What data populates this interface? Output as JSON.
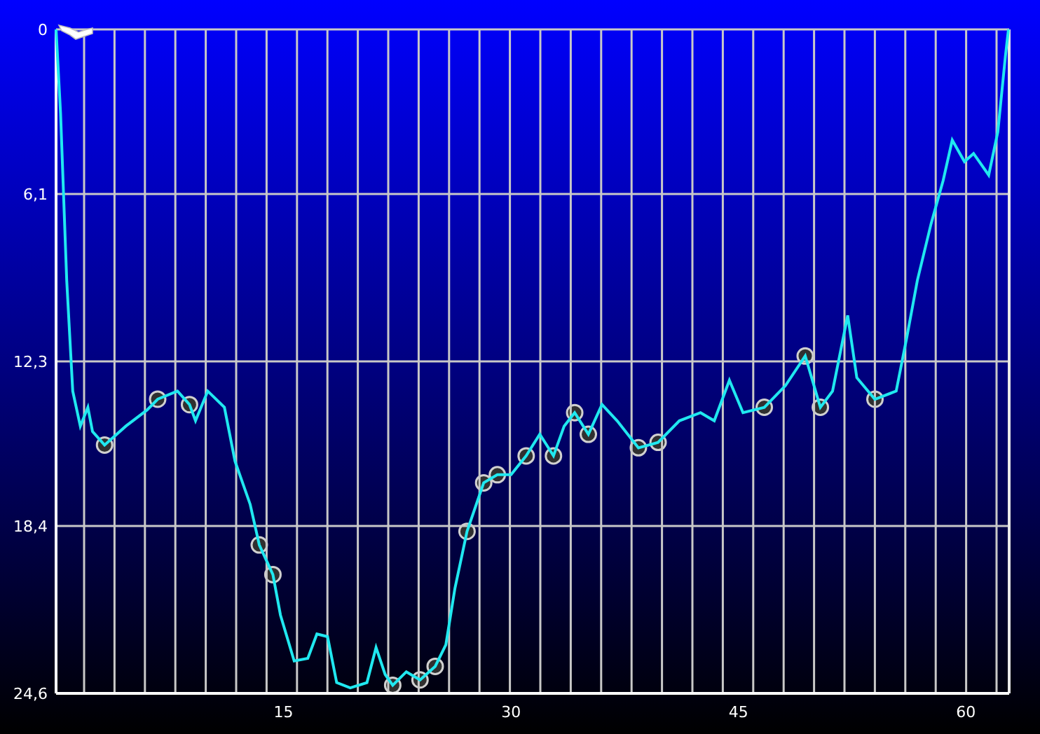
{
  "chart_data": {
    "type": "line",
    "grid": true,
    "xlim": [
      0,
      62.85
    ],
    "ylim": [
      24.6,
      0
    ],
    "xticks": [
      15,
      30,
      45,
      60
    ],
    "yticks": [
      {
        "value": 0,
        "label": "0"
      },
      {
        "value": 6.1,
        "label": "6,1"
      },
      {
        "value": 12.3,
        "label": "12,3"
      },
      {
        "value": 18.4,
        "label": "18,4"
      },
      {
        "value": 24.6,
        "label": "24,6"
      }
    ],
    "x": [
      0,
      0.3,
      0.7,
      1.1,
      1.6,
      2.1,
      2.4,
      3.2,
      4.6,
      6.0,
      6.7,
      8.0,
      8.8,
      9.2,
      10,
      11.1,
      11.8,
      12.8,
      13.4,
      14.3,
      14.8,
      15.7,
      16.6,
      17.2,
      17.9,
      18.5,
      19.4,
      20.5,
      21.1,
      21.7,
      22.2,
      23.1,
      24.0,
      25.0,
      25.7,
      26.3,
      27.1,
      28.2,
      29.1,
      30.0,
      31.0,
      31.9,
      32.8,
      33.5,
      34.2,
      35.1,
      36.0,
      37.0,
      38.4,
      39.7,
      41.1,
      42.5,
      43.4,
      44.4,
      45.3,
      46.7,
      48.1,
      49.4,
      50.4,
      51.2,
      52.2,
      52.8,
      54.0,
      55.4,
      56.1,
      56.8,
      57.7,
      58.5,
      59.1,
      59.9,
      60.5,
      61.5,
      62.1,
      62.6,
      62.8
    ],
    "series": [
      {
        "color": "#20e8f0",
        "values": [
          0,
          3.1,
          9.3,
          13.4,
          14.7,
          14.0,
          14.9,
          15.4,
          14.7,
          14.1,
          13.7,
          13.4,
          13.9,
          14.5,
          13.4,
          14.0,
          16.0,
          17.6,
          19.1,
          20.2,
          21.7,
          23.4,
          23.3,
          22.4,
          22.5,
          24.2,
          24.4,
          24.2,
          22.9,
          23.9,
          24.3,
          23.8,
          24.1,
          23.6,
          22.8,
          20.7,
          18.6,
          16.8,
          16.5,
          16.5,
          15.8,
          15.0,
          15.8,
          14.7,
          14.2,
          15.0,
          13.9,
          14.5,
          15.5,
          15.3,
          14.5,
          14.2,
          14.5,
          13.0,
          14.2,
          14.0,
          13.2,
          12.1,
          14.0,
          13.4,
          10.6,
          12.9,
          13.7,
          13.4,
          11.4,
          9.3,
          7.2,
          5.6,
          4.1,
          4.9,
          4.6,
          5.4,
          3.8,
          1.0,
          0
        ]
      }
    ]
  }
}
